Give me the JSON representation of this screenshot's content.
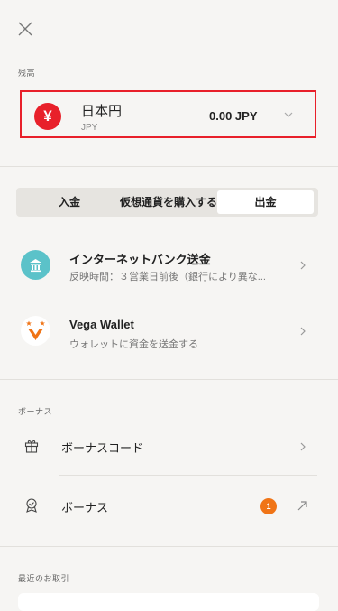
{
  "header": {
    "close_icon": "close-icon"
  },
  "balance": {
    "section_label": "残高",
    "currency_name": "日本円",
    "currency_code": "JPY",
    "currency_symbol": "¥",
    "amount": "0.00 JPY",
    "accent_color": "#e8202a"
  },
  "tabs": [
    {
      "label": "入金",
      "active": false
    },
    {
      "label": "仮想通貨を購入する",
      "active": false
    },
    {
      "label": "出金",
      "active": true
    }
  ],
  "methods": [
    {
      "title": "インターネットバンク送金",
      "subtitle": "反映時間：３営業日前後（銀行により異な...",
      "icon": "bank-icon",
      "icon_color": "#5bc2c9"
    },
    {
      "title": "Vega Wallet",
      "subtitle": "ウォレットに資金を送金する",
      "icon": "vega-wallet-icon",
      "icon_color": "#f07416"
    }
  ],
  "bonus": {
    "section_label": "ボーナス",
    "items": [
      {
        "label": "ボーナスコード",
        "icon": "gift-icon"
      },
      {
        "label": "ボーナス",
        "icon": "award-icon",
        "badge": "1",
        "badge_color": "#f07416"
      }
    ]
  },
  "recent": {
    "section_label": "最近のお取引"
  }
}
